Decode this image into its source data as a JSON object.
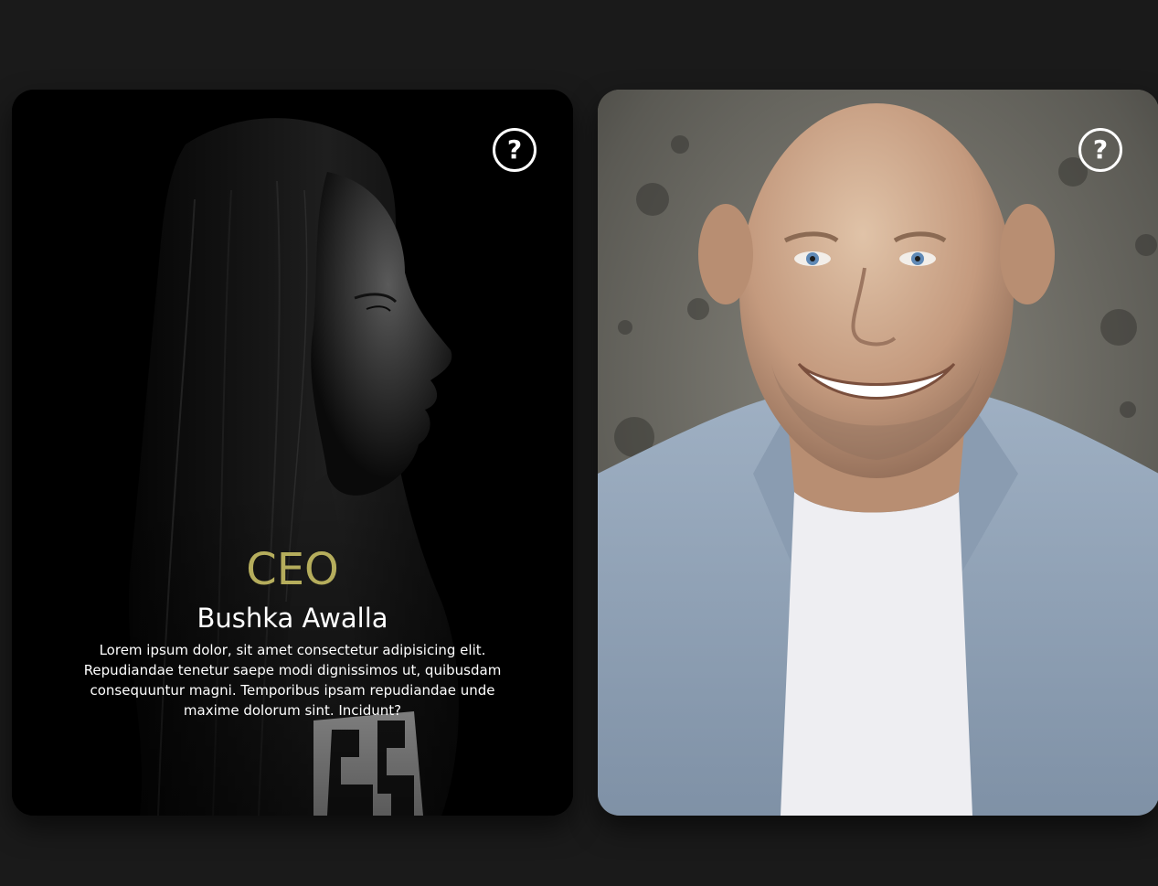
{
  "cards": [
    {
      "role": "CEO",
      "name": "Bushka Awalla",
      "description": "Lorem ipsum dolor, sit amet consectetur adipisicing elit. Repudiandae tenetur saepe modi dignissimos ut, quibusdam consequuntur magni. Temporibus ipsam repudiandae unde maxime dolorum sint. Incidunt?",
      "help_icon": "question-circle-icon",
      "photo": "woman-profile-portrait"
    },
    {
      "help_icon": "question-circle-icon",
      "photo": "smiling-bald-man-portrait"
    }
  ],
  "colors": {
    "background": "#1a1a1a",
    "role_accent": "#b5ad5c",
    "text": "#ffffff"
  }
}
